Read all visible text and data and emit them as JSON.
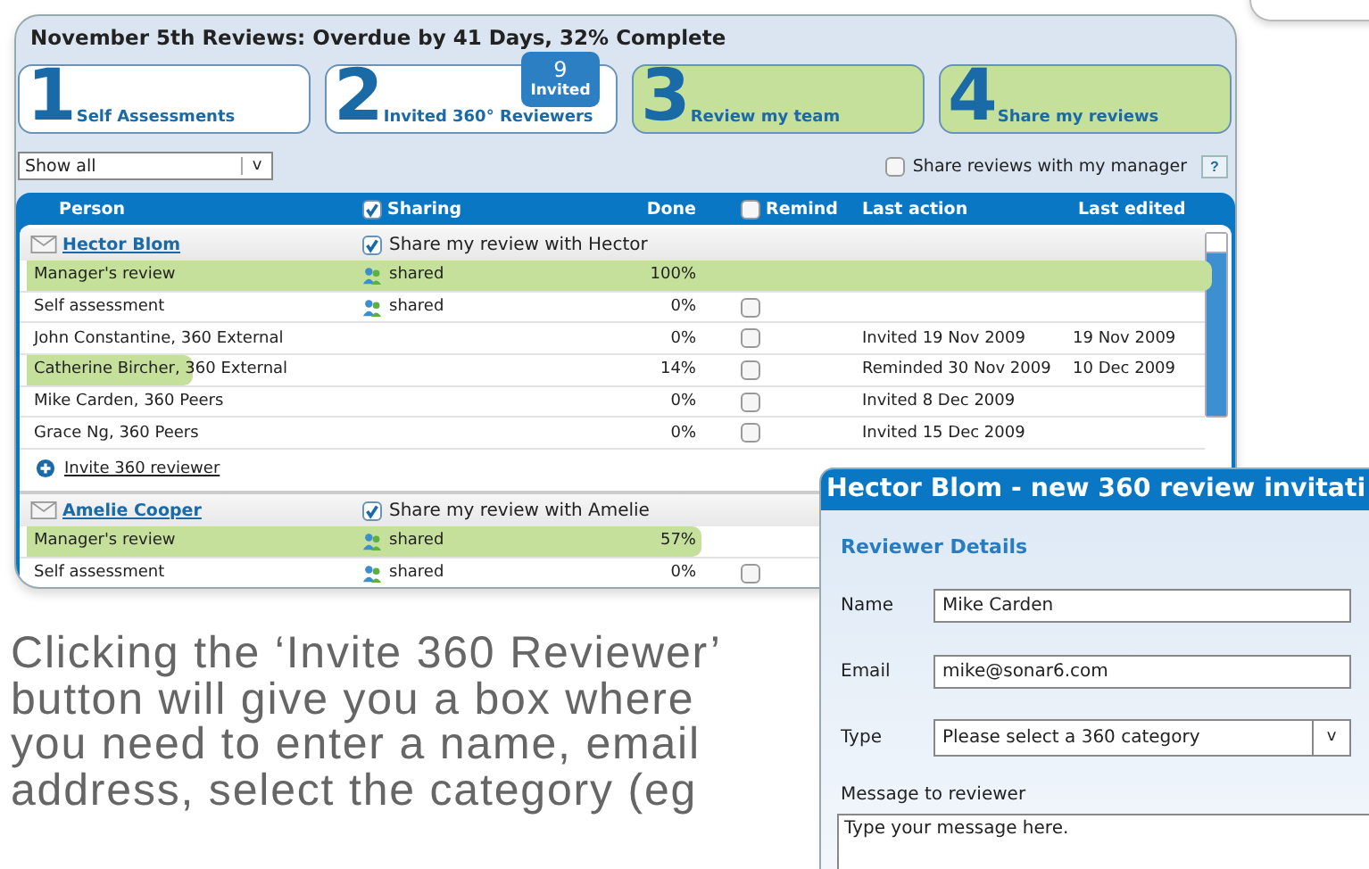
{
  "panel": {
    "title": "November 5th Reviews: Overdue by 41 Days, 32% Complete",
    "steps": [
      {
        "number": "1",
        "label": "Self Assessments",
        "highlighted": false
      },
      {
        "number": "2",
        "label": "Invited 360° Reviewers",
        "highlighted": false,
        "badge_count": "9",
        "badge_label": "Invited"
      },
      {
        "number": "3",
        "label": "Review my team",
        "highlighted": true
      },
      {
        "number": "4",
        "label": "Share my reviews",
        "highlighted": true
      }
    ],
    "filter": {
      "value": "Show all",
      "button": "v"
    },
    "share_with_manager": {
      "label": "Share reviews with my manager",
      "checked": false
    },
    "help": "?",
    "columns": [
      {
        "label": "Person"
      },
      {
        "label": "Sharing",
        "checked": true
      },
      {
        "label": "Done"
      },
      {
        "label": "Remind",
        "checked": false
      },
      {
        "label": "Last action"
      },
      {
        "label": "Last edited"
      }
    ],
    "groups": [
      {
        "name": "Hector Blom",
        "share_label": "Share my review with Hector",
        "share_checked": true,
        "invite_label": "Invite 360 reviewer",
        "rows": [
          {
            "person": "Manager's review",
            "sharing": "shared",
            "done": "100%",
            "level": 1
          },
          {
            "person": "Self assessment",
            "sharing": "shared",
            "done": "0%",
            "remind": false
          },
          {
            "person": "John Constantine, 360 External",
            "done": "0%",
            "remind": false,
            "last_action": "Invited 19 Nov 2009",
            "last_edited": "19 Nov 2009"
          },
          {
            "person": "Catherine Bircher, 360 External",
            "done": "14%",
            "level": 0.14,
            "remind": false,
            "last_action": "Reminded 30 Nov 2009",
            "last_edited": "10 Dec 2009"
          },
          {
            "person": "Mike Carden, 360 Peers",
            "done": "0%",
            "remind": false,
            "last_action": "Invited 8 Dec 2009"
          },
          {
            "person": "Grace Ng, 360 Peers",
            "done": "0%",
            "remind": false,
            "last_action": "Invited 15 Dec 2009"
          }
        ]
      },
      {
        "name": "Amelie Cooper",
        "share_label": "Share my review with Amelie",
        "share_checked": true,
        "rows": [
          {
            "person": "Manager's review",
            "sharing": "shared",
            "done": "57%",
            "level": 0.57
          },
          {
            "person": "Self assessment",
            "sharing": "shared",
            "done": "0%",
            "remind": false
          }
        ]
      }
    ]
  },
  "caption_lines": [
    "Clicking the ‘Invite 360 Reviewer’",
    "button will give you a box where",
    "you need to enter a name, email",
    "address, select the category (eg"
  ],
  "dialog": {
    "title": "Hector Blom - new 360 review invitati",
    "section": "Reviewer Details",
    "name": {
      "label": "Name",
      "value": "Mike Carden"
    },
    "email": {
      "label": "Email",
      "value": "mike@sonar6.com"
    },
    "type": {
      "label": "Type",
      "value": "Please select a 360 category",
      "button": "v"
    },
    "message": {
      "label": "Message to reviewer",
      "placeholder": "Type your message here."
    }
  }
}
